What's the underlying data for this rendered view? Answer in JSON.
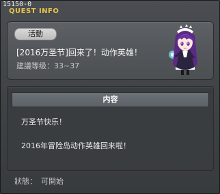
{
  "window": {
    "id": "15150-0",
    "title": "QUEST INFO"
  },
  "quest": {
    "category": "活動",
    "name": "[2016万圣节]回来了！动作英雄！",
    "level_text": "建議等级：33~37"
  },
  "npc": {
    "icon": "npc-portrait"
  },
  "content": {
    "header": "内容",
    "lines": [
      "万圣节快乐！",
      "2016年冒险岛动作英雄回来啦！"
    ]
  },
  "status": {
    "label": "狀態：",
    "value": "可開始"
  },
  "colors": {
    "title_yellow": "#e9c44c",
    "panel": "#55595d",
    "background": "#3a3d40"
  }
}
